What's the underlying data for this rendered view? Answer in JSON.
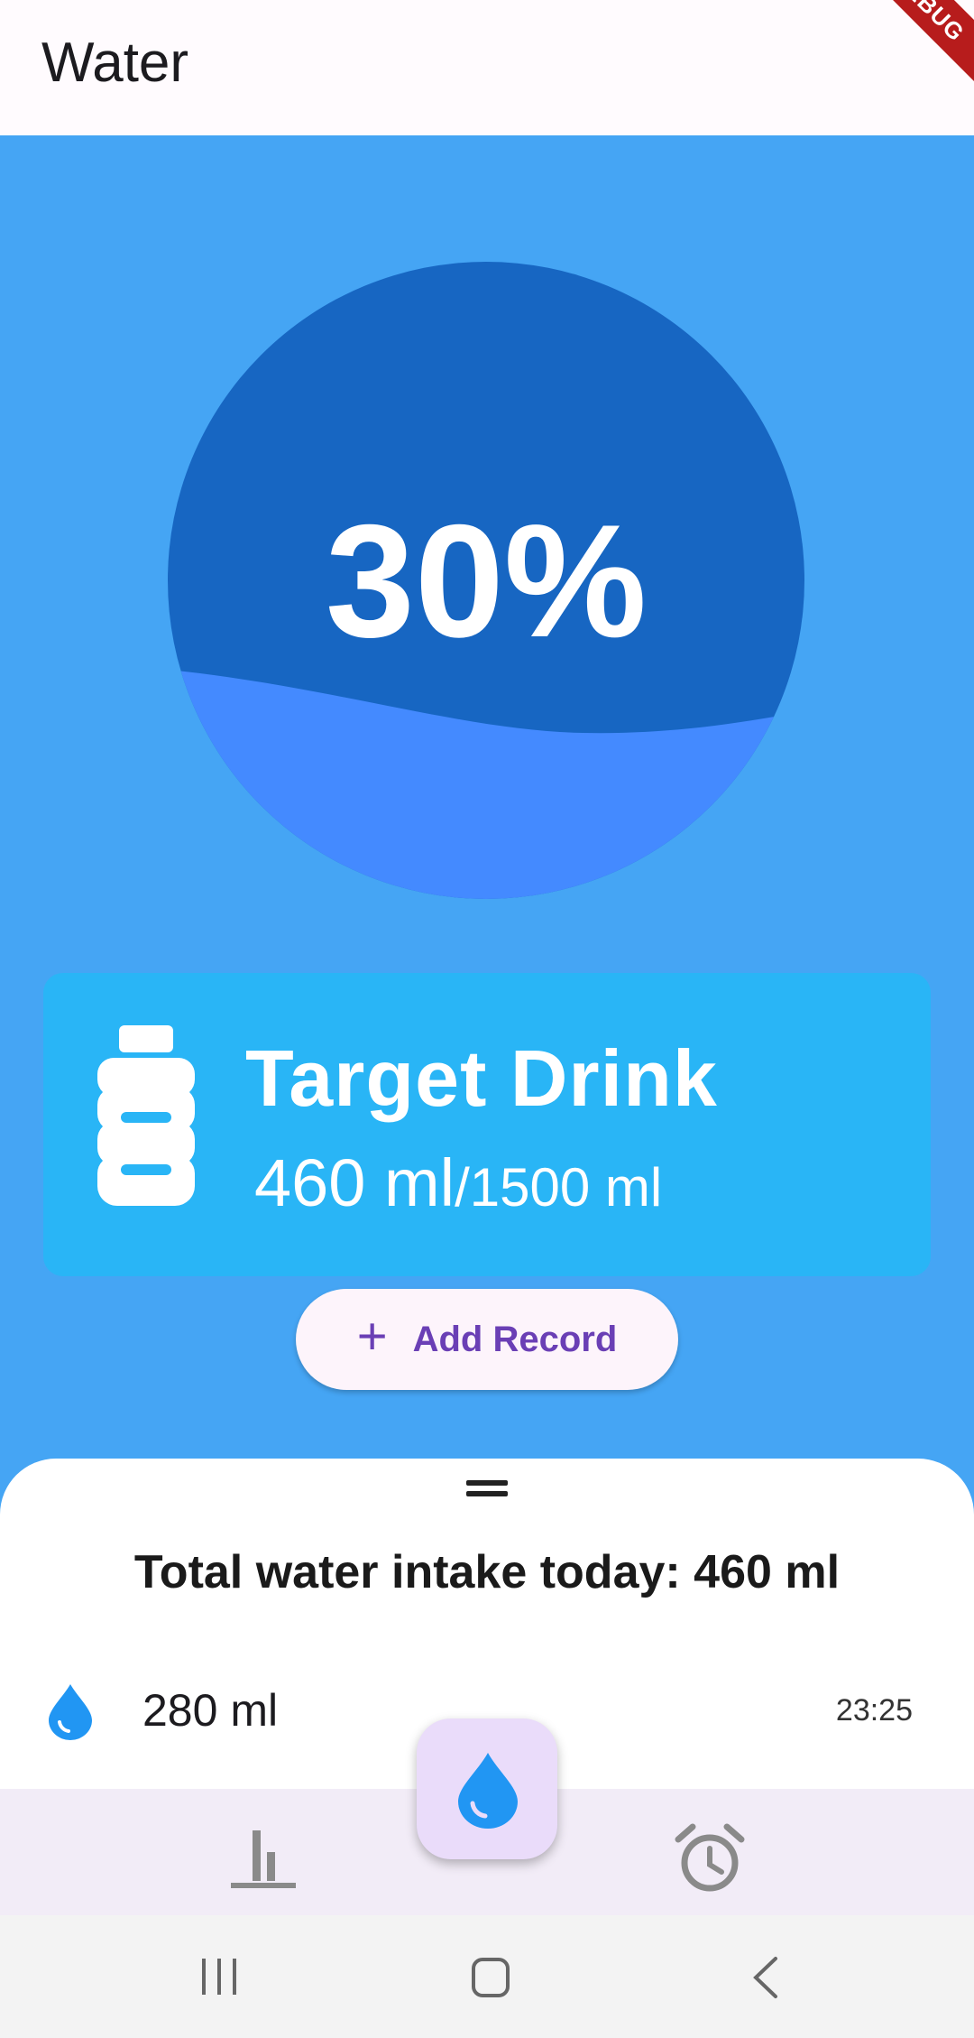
{
  "appbar": {
    "title": "Water",
    "debug_banner": "DEBUG"
  },
  "progress": {
    "percent_label": "30%",
    "fill_fraction": 0.3
  },
  "target": {
    "title": "Target Drink",
    "current": "460 ml",
    "total": "/1500 ml"
  },
  "add_button": {
    "icon": "plus-icon",
    "label": "Add Record"
  },
  "sheet": {
    "title": "Total water intake today: 460 ml",
    "records": [
      {
        "icon": "water-drop-icon",
        "amount": "280 ml",
        "time": "23:25"
      }
    ]
  },
  "bottom_nav": {
    "items": [
      {
        "icon": "bar-chart-icon"
      },
      {
        "icon": "water-drop-icon",
        "active": true
      },
      {
        "icon": "alarm-clock-icon"
      }
    ]
  },
  "system_nav": {
    "items": [
      "recent-apps-icon",
      "home-icon",
      "back-icon"
    ]
  },
  "colors": {
    "background": "#45a5f4",
    "circle_top": "#1766c2",
    "circle_water": "#448aff",
    "card": "#29b5f6",
    "button_text": "#6a3fb5",
    "fab": "#eadcfa",
    "drop": "#2196f3"
  }
}
